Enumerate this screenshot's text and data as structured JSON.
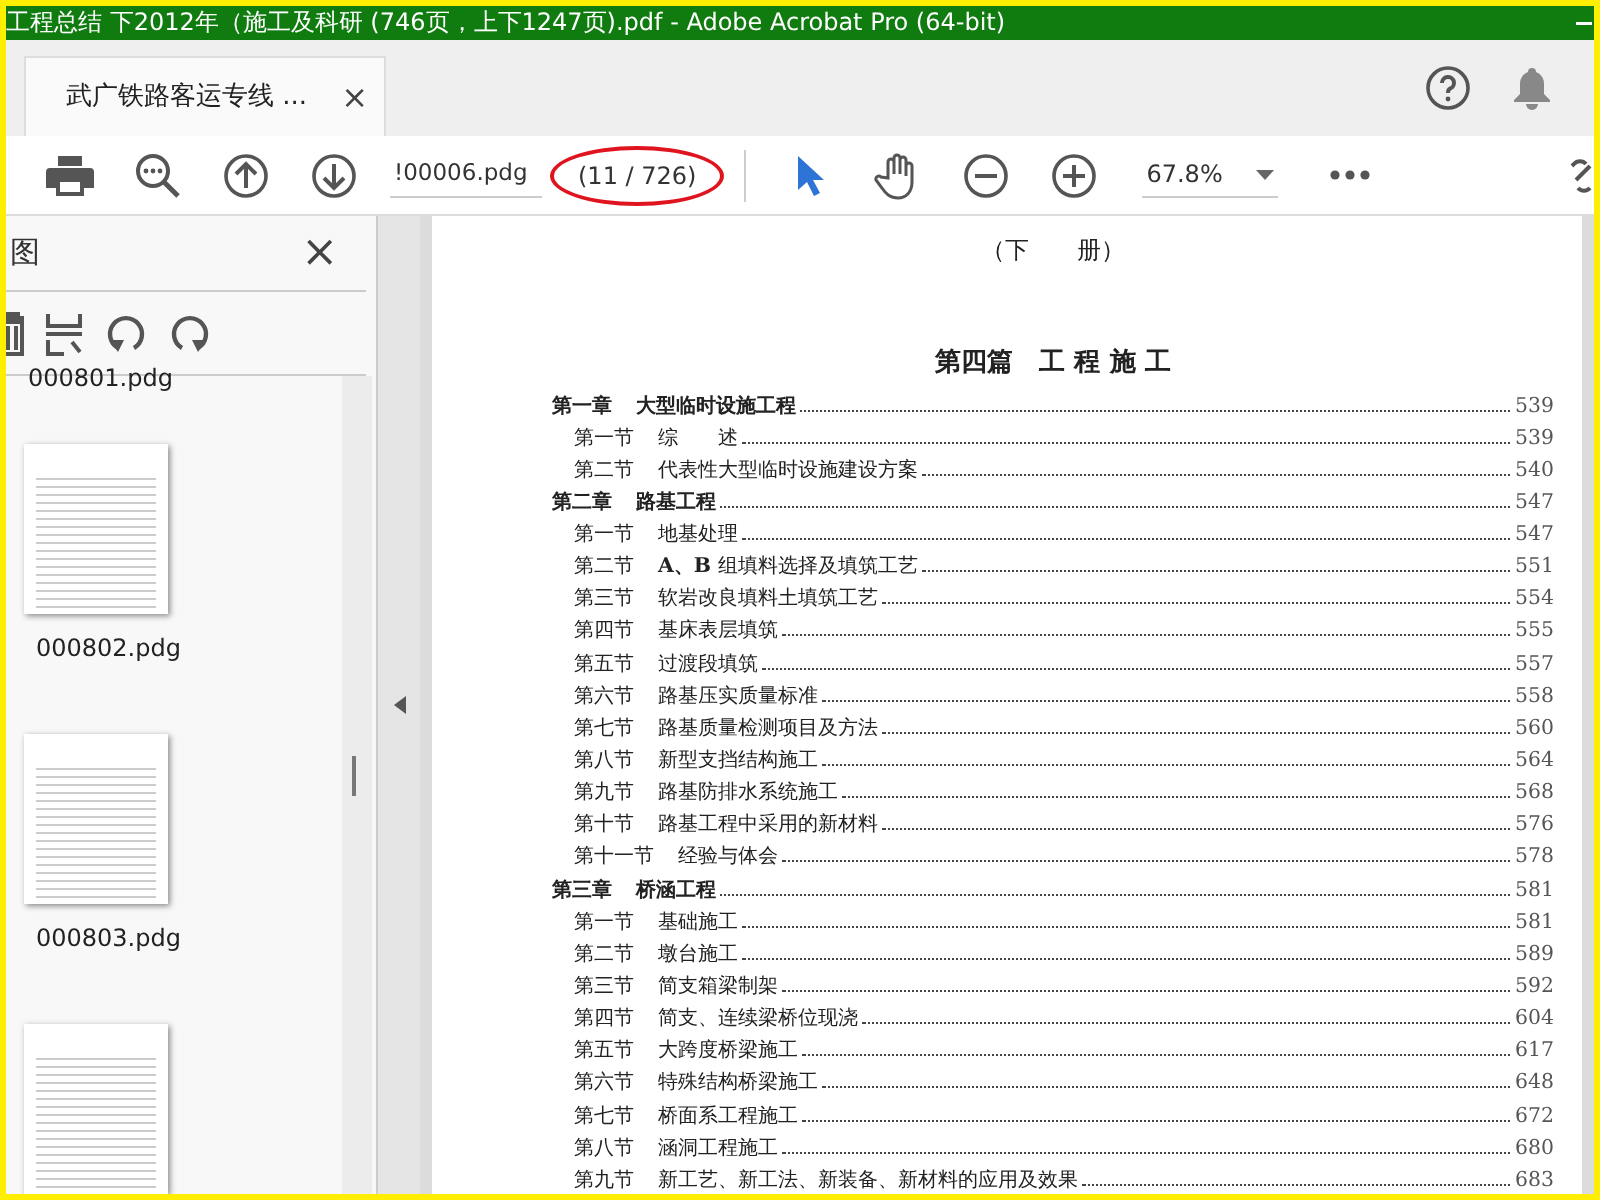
{
  "window": {
    "title": "工程总结 下2012年（施工及科研 (746页，上下1247页).pdf - Adobe Acrobat Pro (64-bit)"
  },
  "tabs": [
    {
      "label": "武广铁路客运专线 ...",
      "close": "×",
      "selected": true
    }
  ],
  "toolbar": {
    "page_field": "!00006.pdg",
    "page_count": "(11 / 726)",
    "zoom": "67.8%",
    "tools": [
      {
        "kind": "select",
        "selected": true
      },
      {
        "kind": "hand",
        "selected": false
      }
    ]
  },
  "side_panel": {
    "title": "图",
    "close": "×",
    "thumbnails": [
      {
        "kind": "label",
        "label": "000801.pdg"
      },
      {
        "kind": "page",
        "label": "000802.pdg"
      },
      {
        "kind": "page",
        "label": "000803.pdg"
      },
      {
        "kind": "page"
      }
    ]
  },
  "document": {
    "volume": "（下　　册）",
    "part_title": "第四篇　工 程 施 工",
    "toc": [
      {
        "kind": "chapter",
        "label": "第一章",
        "title": "大型临时设施工程",
        "page": "539"
      },
      {
        "kind": "section",
        "label": "第一节",
        "title": "综　　述",
        "page": "539"
      },
      {
        "kind": "section",
        "label": "第二节",
        "title": "代表性大型临时设施建设方案",
        "page": "540"
      },
      {
        "kind": "chapter",
        "label": "第二章",
        "title": "路基工程",
        "page": "547"
      },
      {
        "kind": "section",
        "label": "第一节",
        "title": "地基处理",
        "page": "547"
      },
      {
        "kind": "section",
        "label": "第二节",
        "title": "**A、B** 组填料选择及填筑工艺",
        "page": "551"
      },
      {
        "kind": "section",
        "label": "第三节",
        "title": "软岩改良填料土填筑工艺",
        "page": "554"
      },
      {
        "kind": "section",
        "label": "第四节",
        "title": "基床表层填筑",
        "page": "555"
      },
      {
        "kind": "section",
        "label": "第五节",
        "title": "过渡段填筑",
        "page": "557"
      },
      {
        "kind": "section",
        "label": "第六节",
        "title": "路基压实质量标准",
        "page": "558"
      },
      {
        "kind": "section",
        "label": "第七节",
        "title": "路基质量检测项目及方法",
        "page": "560"
      },
      {
        "kind": "section",
        "label": "第八节",
        "title": "新型支挡结构施工",
        "page": "564"
      },
      {
        "kind": "section",
        "label": "第九节",
        "title": "路基防排水系统施工",
        "page": "568"
      },
      {
        "kind": "section",
        "label": "第十节",
        "title": "路基工程中采用的新材料",
        "page": "576"
      },
      {
        "kind": "section",
        "label": "第十一节",
        "title": "经验与体会",
        "page": "578"
      },
      {
        "kind": "chapter",
        "label": "第三章",
        "title": "桥涵工程",
        "page": "581"
      },
      {
        "kind": "section",
        "label": "第一节",
        "title": "基础施工",
        "page": "581"
      },
      {
        "kind": "section",
        "label": "第二节",
        "title": "墩台施工",
        "page": "589"
      },
      {
        "kind": "section",
        "label": "第三节",
        "title": "简支箱梁制架",
        "page": "592"
      },
      {
        "kind": "section",
        "label": "第四节",
        "title": "简支、连续梁桥位现浇",
        "page": "604"
      },
      {
        "kind": "section",
        "label": "第五节",
        "title": "大跨度桥梁施工",
        "page": "617"
      },
      {
        "kind": "section",
        "label": "第六节",
        "title": "特殊结构桥梁施工",
        "page": "648"
      },
      {
        "kind": "section",
        "label": "第七节",
        "title": "桥面系工程施工",
        "page": "672"
      },
      {
        "kind": "section",
        "label": "第八节",
        "title": "涵洞工程施工",
        "page": "680"
      },
      {
        "kind": "section",
        "label": "第九节",
        "title": "新工艺、新工法、新装备、新材料的应用及效果",
        "page": "683"
      }
    ]
  }
}
